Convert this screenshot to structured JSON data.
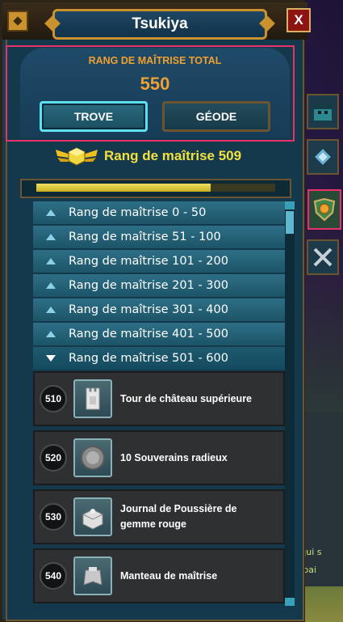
{
  "window": {
    "title": "Tsukiya",
    "close_label": "X"
  },
  "header": {
    "title": "RANG DE MAÎTRISE TOTAL",
    "total_value": "550",
    "tabs": [
      {
        "label": "TROVE",
        "selected": true
      },
      {
        "label": "GÉODE",
        "selected": false
      }
    ]
  },
  "rank": {
    "label": "Rang de maîtrise 509"
  },
  "progress": {
    "fraction": 0.73
  },
  "categories": [
    {
      "label": "Rang de maîtrise 0 - 50",
      "expanded": false
    },
    {
      "label": "Rang de maîtrise 51 - 100",
      "expanded": false
    },
    {
      "label": "Rang de maîtrise 101 - 200",
      "expanded": false
    },
    {
      "label": "Rang de maîtrise 201 - 300",
      "expanded": false
    },
    {
      "label": "Rang de maîtrise 301 - 400",
      "expanded": false
    },
    {
      "label": "Rang de maîtrise 401 - 500",
      "expanded": false
    },
    {
      "label": "Rang de maîtrise 501 - 600",
      "expanded": true
    }
  ],
  "rewards": [
    {
      "level": "510",
      "label": "Tour de château supérieure",
      "icon": "tower-icon"
    },
    {
      "level": "520",
      "label": "10 Souverains radieux",
      "icon": "coin-icon"
    },
    {
      "level": "530",
      "label": "Journal de Poussière de gemme rouge",
      "icon": "chest-icon"
    },
    {
      "level": "540",
      "label": "Manteau de maîtrise",
      "icon": "cape-icon"
    }
  ],
  "side_tabs": [
    {
      "icon": "character-icon",
      "active": false
    },
    {
      "icon": "gem-icon",
      "active": false
    },
    {
      "icon": "mastery-badge-icon",
      "active": true
    },
    {
      "icon": "crossed-swords-icon",
      "active": false
    }
  ],
  "chat_fragments": [
    "] :",
    "e qui s",
    "la pai"
  ],
  "colors": {
    "accent_orange": "#f0a030",
    "rank_yellow": "#f0e040",
    "highlight": "#e8336a",
    "selected_border": "#5fe0f0"
  }
}
